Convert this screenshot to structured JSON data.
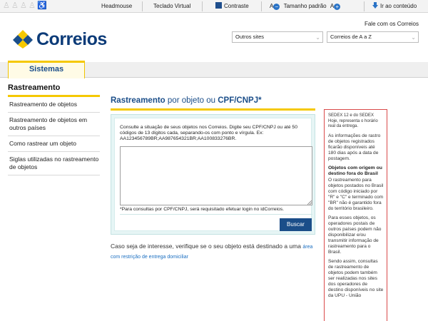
{
  "accessibility_bar": {
    "items": [
      "Headmouse",
      "Teclado Virtual",
      "Contraste",
      "Tamanho padrão",
      "Ir ao conteúdo"
    ],
    "font_minus": "A",
    "font_plus": "A"
  },
  "header": {
    "logo_text": "Correios",
    "contact_link": "Fale com os Correios",
    "select_outros_sites": "Outros sites",
    "select_a_z": "Correios de A a Z"
  },
  "nav": {
    "tab_label": "Sistemas"
  },
  "sidebar": {
    "title": "Rastreamento",
    "items": [
      "Rastreamento de objetos",
      "Rastreamento de objetos em outros países",
      "Como rastrear um objeto",
      "Siglas utilizadas no rastreamento de objetos"
    ]
  },
  "main": {
    "title_part1": "Rastreamento",
    "title_part2": " por objeto ou ",
    "title_part3": "CPF/CNPJ*",
    "description": "Consulte a situação de seus objetos nos Correios. Digite seu CPF/CNPJ ou até 50 códigos de 13 dígitos cada, separando-os com ponto e vírgula. Ex: AA123456789BR;AA987654321BR;AA100833276BR.",
    "textarea_value": "",
    "note": "*Para consultas por CPF/CNPJ, será requisitado efetuar login no idCorreios.",
    "search_button": "Buscar",
    "interest_text": "Caso seja de interesse, verifique se o seu objeto está destinado a uma ",
    "interest_link": "área com restrição de entrega domiciliar"
  },
  "info_panel": {
    "p1": "SEDEX 12 e do SEDEX Hoje, representa o horário real da entrega.",
    "p2": "As informações de rastro de objetos registrados ficarão disponíveis até 180 dias após a data de postagem.",
    "h1": "Objetos com origem ou destino fora do Brasil",
    "p3": "O rastreamento para objetos postados no Brasil com código iniciado por \"R\" e \"C\" e terminado com \"BR\" não é garantido fora do território brasileiro.",
    "p4": "Para esses objetos, os operadores postais de outros países podem não disponibilizar e/ou transmitir informação de rastreamento para o Brasil.",
    "p5": "Sendo assim, consultas de rastreamento de objetos podem também ser realizadas nos sites dos operadores de destino disponíveis no site da UPU - União"
  },
  "colors": {
    "brand_blue": "#1b4e89",
    "brand_yellow": "#f5c800",
    "panel_border": "#d94a4a",
    "button": "#1b4e89"
  }
}
